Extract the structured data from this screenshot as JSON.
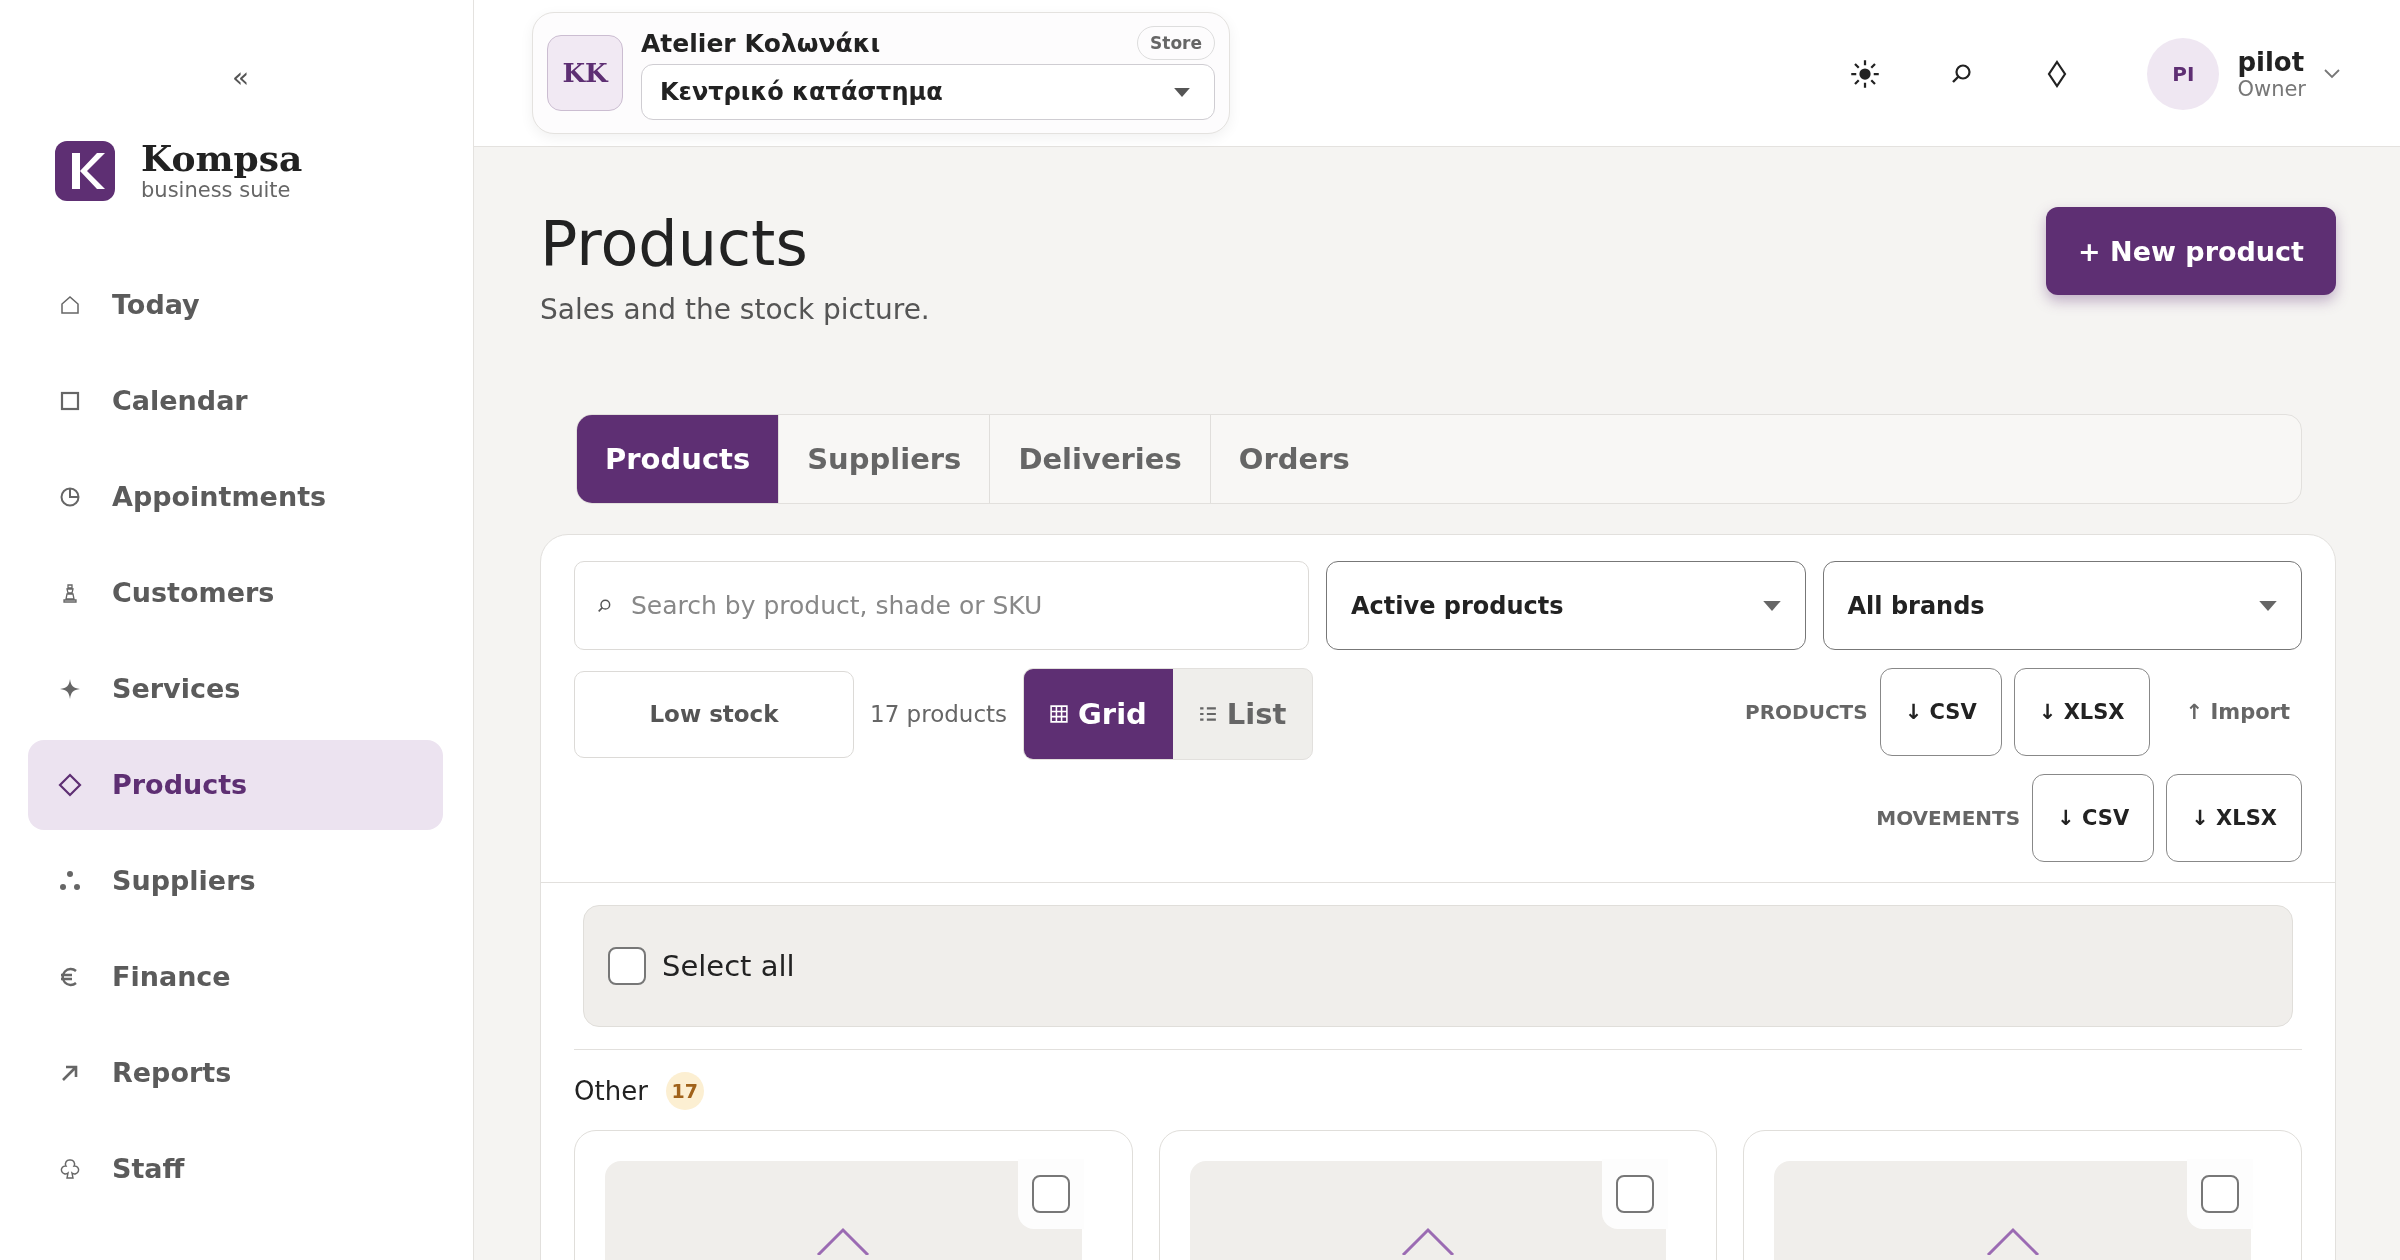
{
  "sidebar": {
    "collapse": "«",
    "brand": {
      "name": "Kompsa",
      "tagline": "business suite"
    },
    "items": [
      {
        "label": "Today",
        "selected": false
      },
      {
        "label": "Calendar",
        "selected": false
      },
      {
        "label": "Appointments",
        "selected": false
      },
      {
        "label": "Customers",
        "selected": false
      },
      {
        "label": "Services",
        "selected": false
      },
      {
        "label": "Products",
        "selected": true
      },
      {
        "label": "Suppliers",
        "selected": false
      },
      {
        "label": "Finance",
        "selected": false
      },
      {
        "label": "Reports",
        "selected": false
      },
      {
        "label": "Staff",
        "selected": false
      }
    ]
  },
  "header": {
    "store": {
      "initials": "KK",
      "name": "Atelier Κολωνάκι",
      "badge": "Store",
      "location": "Κεντρικό κατάστημα"
    },
    "user": {
      "initials": "PI",
      "name": "pilot",
      "role": "Owner"
    }
  },
  "page": {
    "title": "Products",
    "subtitle": "Sales and the stock picture.",
    "new_button": "+ New product"
  },
  "tabs": [
    {
      "label": "Products",
      "selected": true
    },
    {
      "label": "Suppliers",
      "selected": false
    },
    {
      "label": "Deliveries",
      "selected": false
    },
    {
      "label": "Orders",
      "selected": false
    }
  ],
  "filters": {
    "search": {
      "placeholder": "Search by product, shade or SKU"
    },
    "status": "Active products",
    "brand": "All brands",
    "low_stock": "Low stock",
    "count": "17 products",
    "views": [
      {
        "label": "Grid",
        "selected": true
      },
      {
        "label": "List",
        "selected": false
      }
    ]
  },
  "exports": [
    {
      "label": "PRODUCTS",
      "buttons": [
        "↓ CSV",
        "↓ XLSX"
      ],
      "import": "↑ Import"
    },
    {
      "label": "MOVEMENTS",
      "buttons": [
        "↓ CSV",
        "↓ XLSX"
      ]
    }
  ],
  "select_all": {
    "label": "Select all",
    "checked": false
  },
  "group": {
    "name": "Other",
    "count": "17"
  },
  "cards": [
    {
      "checked": false
    },
    {
      "checked": false
    },
    {
      "checked": false
    }
  ]
}
